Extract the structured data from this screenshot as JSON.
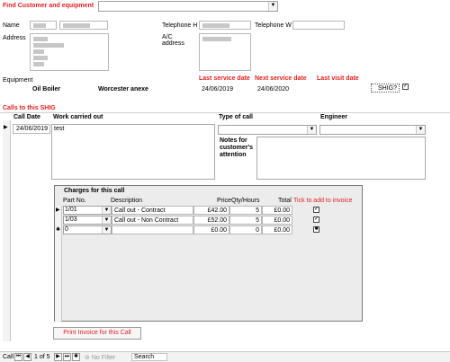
{
  "header": {
    "find_label": "Find Customer and equipment",
    "name_label": "Name",
    "tel_h_label": "Telephone H",
    "tel_w_label": "Telephone W",
    "address_label": "Address",
    "ac_label": "A/C",
    "ac_label2": "address"
  },
  "equipment": {
    "label": "Equipment",
    "type": "Oil Boiler",
    "location": "Worcester anexe",
    "last_service_label": "Last service date",
    "last_service": "24/06/2019",
    "next_service_label": "Next service date",
    "next_service": "24/06/2020",
    "last_visit_label": "Last visit date",
    "last_visit": "",
    "shig_label": "SHIG?",
    "shig_checked": "✓"
  },
  "calls": {
    "section_title": "Calls to this SHIG",
    "call_date_header": "Call Date",
    "work_header": "Work carried out",
    "type_header": "Type of call",
    "engineer_header": "Engineer",
    "call_date": "24/06/2019",
    "work": "test",
    "notes_label": "Notes for customer's attention",
    "record_marker": "▶"
  },
  "charges": {
    "title": "Charges for this call",
    "col_part": "Part No.",
    "col_desc": "Description",
    "col_price": "Price",
    "col_qty": "Qty/Hours",
    "col_total": "Total",
    "col_tick": "Tick to add to invoice",
    "rows": [
      {
        "marker": "▶",
        "part": "1/01",
        "desc": "Call out - Contract",
        "price": "£42.00",
        "qty": "5",
        "total": "£0.00",
        "tick": "✓"
      },
      {
        "marker": "",
        "part": "1/03",
        "desc": "Call out - Non Contract",
        "price": "£52.00",
        "qty": "5",
        "total": "£0.00",
        "tick": "✓"
      },
      {
        "marker": "✱",
        "part": "0",
        "desc": "",
        "price": "£0.00",
        "qty": "0",
        "total": "£0.00",
        "tick": "■"
      }
    ],
    "print_button": "Print Invoice for this Call"
  },
  "navigation": {
    "record_label": "Call",
    "position": "1 of 5",
    "filter": "No Filter",
    "search": "Search"
  }
}
